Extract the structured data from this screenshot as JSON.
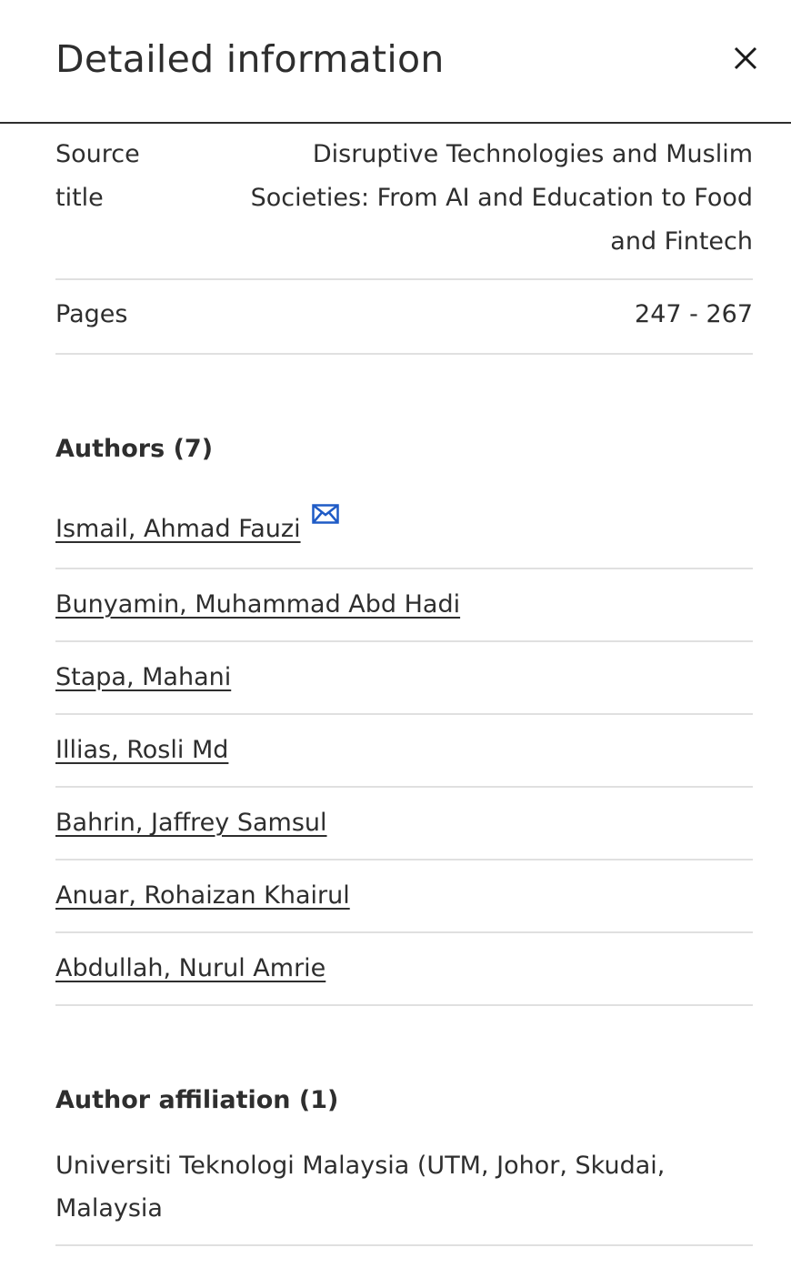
{
  "header": {
    "title": "Detailed information",
    "close_icon": "close-icon"
  },
  "details": {
    "source_title_label": "Source title",
    "source_title_value": "Disruptive Technologies and Muslim Societies: From AI and Education to Food and Fintech",
    "pages_label": "Pages",
    "pages_value": "247 - 267"
  },
  "authors": {
    "heading": "Authors (7)",
    "list": [
      "Ismail, Ahmad Fauzi",
      "Bunyamin, Muhammad Abd Hadi",
      "Stapa, Mahani",
      "Illias, Rosli Md",
      "Bahrin, Jaffrey Samsul",
      "Anuar, Rohaizan Khairul",
      "Abdullah, Nurul Amrie"
    ],
    "mail_icon": "envelope-icon",
    "mail_icon_color": "#1f5bc6"
  },
  "affiliation": {
    "heading": "Author affiliation (1)",
    "text": "Universiti Teknologi Malaysia (UTM, Johor, Skudai, Malaysia"
  }
}
